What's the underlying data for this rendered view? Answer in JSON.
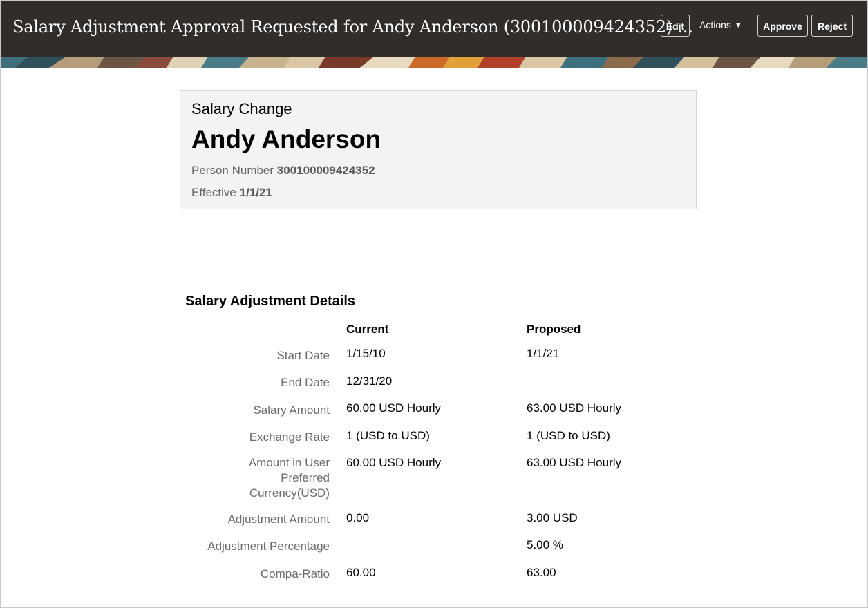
{
  "header": {
    "title": "Salary Adjustment Approval Requested for Andy Anderson (300100009424352) ...",
    "edit_label": "Edit",
    "actions_label": "Actions",
    "approve_label": "Approve",
    "reject_label": "Reject"
  },
  "summary": {
    "subtitle": "Salary Change",
    "name": "Andy Anderson",
    "person_number_label": "Person Number",
    "person_number": "300100009424352",
    "effective_label": "Effective",
    "effective_date": "1/1/21"
  },
  "details": {
    "title": "Salary Adjustment Details",
    "col_current": "Current",
    "col_proposed": "Proposed",
    "rows": [
      {
        "label": "Start Date",
        "current": "1/15/10",
        "proposed": "1/1/21"
      },
      {
        "label": "End Date",
        "current": "12/31/20",
        "proposed": ""
      },
      {
        "label": "Salary Amount",
        "current": "60.00 USD Hourly",
        "proposed": "63.00 USD Hourly"
      },
      {
        "label": "Exchange Rate",
        "current": "1 (USD to USD)",
        "proposed": "1 (USD to USD)"
      },
      {
        "label": "Amount in User Preferred Currency(USD)",
        "current": "60.00 USD Hourly",
        "proposed": "63.00 USD Hourly"
      },
      {
        "label": "Adjustment Amount",
        "current": "0.00",
        "proposed": "3.00 USD"
      },
      {
        "label": "Adjustment Percentage",
        "current": "",
        "proposed": "5.00 %"
      },
      {
        "label": "Compa-Ratio",
        "current": "60.00",
        "proposed": "63.00"
      }
    ]
  },
  "colors": {
    "header_bg": "#312d2a",
    "card_bg": "#f3f3f3",
    "label_gray": "#6b6b6b"
  }
}
